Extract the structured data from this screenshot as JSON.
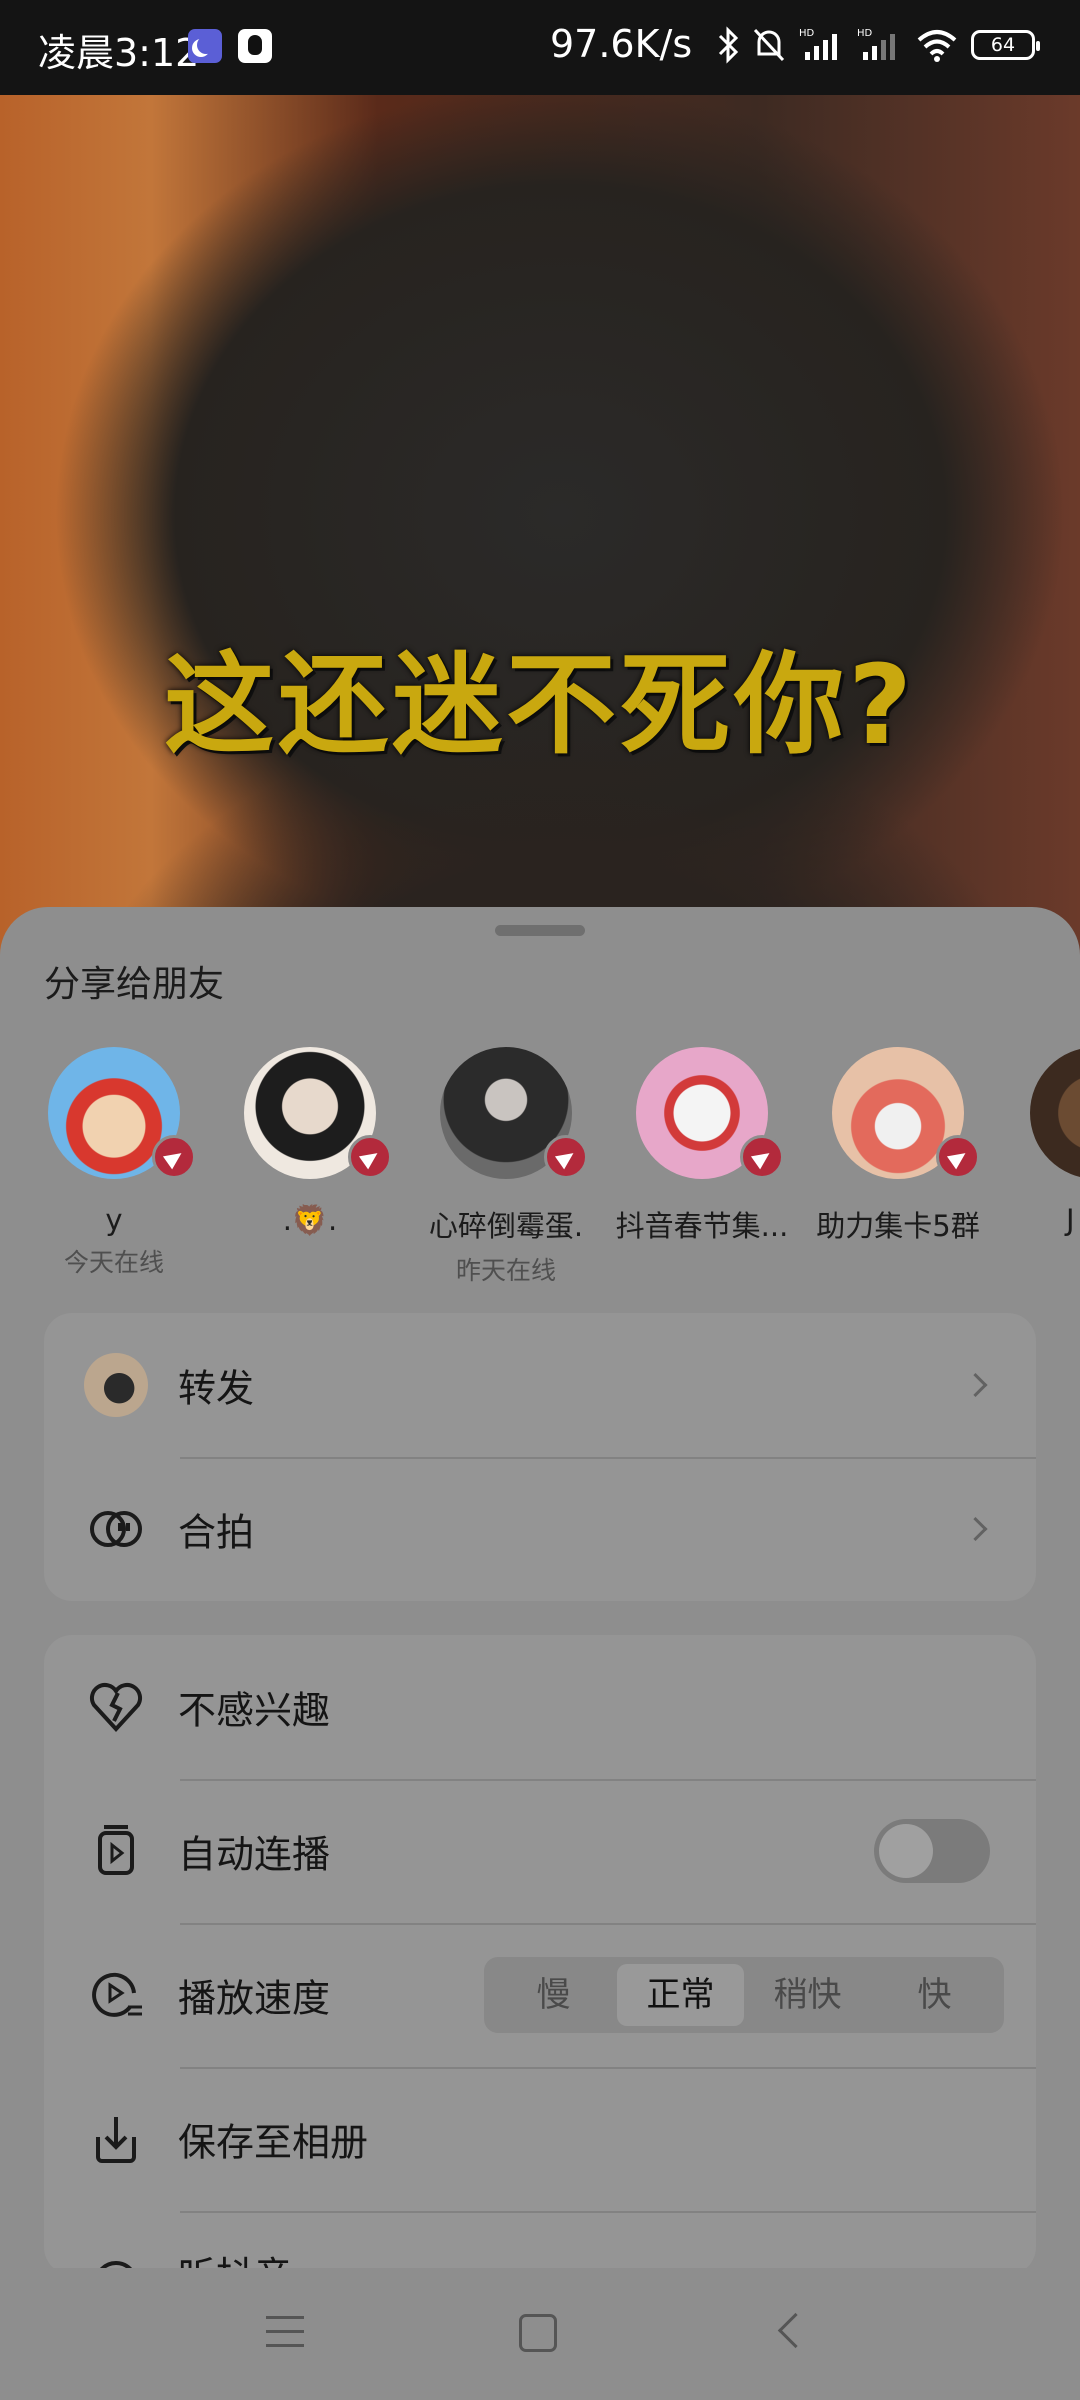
{
  "status_bar": {
    "time": "凌晨3:12",
    "net_rate": "97.6K/s",
    "battery": "64"
  },
  "video": {
    "caption": "这还迷不死你?"
  },
  "share_sheet": {
    "title": "分享给朋友",
    "friends": [
      {
        "name": "y",
        "status": "今天在线"
      },
      {
        "name": ".🦁.",
        "status": ""
      },
      {
        "name": "心碎倒霉蛋.",
        "status": "昨天在线"
      },
      {
        "name": "抖音春节集...",
        "status": ""
      },
      {
        "name": "助力集卡5群",
        "status": ""
      },
      {
        "name": "J",
        "status": ""
      }
    ],
    "actions": {
      "forward": "转发",
      "duet": "合拍"
    },
    "options": {
      "not_interested": "不感兴趣",
      "autoplay": "自动连播",
      "playback_speed": "播放速度",
      "speeds": [
        "慢",
        "正常",
        "稍快",
        "快"
      ],
      "selected_speed": "正常",
      "save_album": "保存至相册",
      "partial_next": "听抖音"
    }
  }
}
